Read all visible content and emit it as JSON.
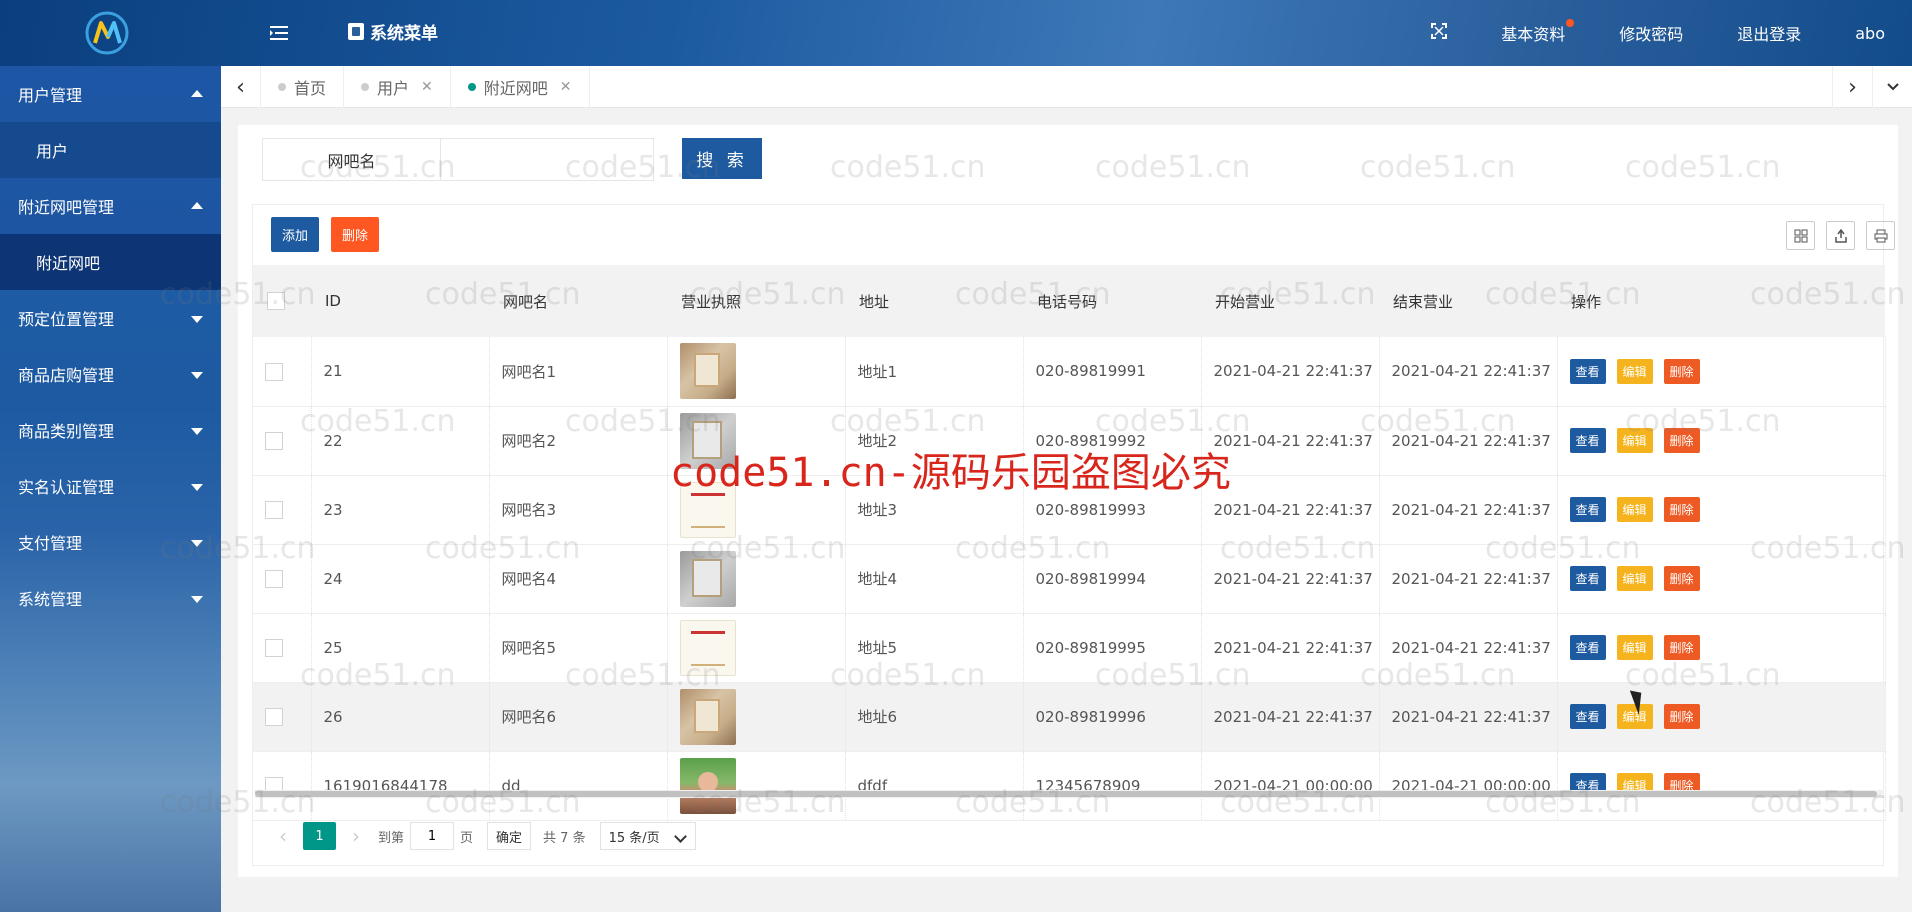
{
  "header": {
    "menu_title": "系统菜单",
    "right_links": [
      "基本资料",
      "修改密码",
      "退出登录"
    ],
    "username": "abo"
  },
  "sidebar": {
    "items": [
      {
        "label": "用户管理",
        "open": true,
        "children": [
          "用户"
        ]
      },
      {
        "label": "附近网吧管理",
        "open": true,
        "children": [
          "附近网吧"
        ]
      },
      {
        "label": "预定位置管理",
        "open": false
      },
      {
        "label": "商品店购管理",
        "open": false
      },
      {
        "label": "商品类别管理",
        "open": false
      },
      {
        "label": "实名认证管理",
        "open": false
      },
      {
        "label": "支付管理",
        "open": false
      },
      {
        "label": "系统管理",
        "open": false
      }
    ]
  },
  "tabs": [
    {
      "label": "首页",
      "closable": false
    },
    {
      "label": "用户",
      "closable": true
    },
    {
      "label": "附近网吧",
      "closable": true,
      "active": true
    }
  ],
  "search": {
    "label": "网吧名",
    "value": "",
    "button": "搜 索"
  },
  "toolbar": {
    "add_label": "添加",
    "delete_label": "删除"
  },
  "table": {
    "columns": [
      "ID",
      "网吧名",
      "营业执照",
      "地址",
      "电话号码",
      "开始营业",
      "结束营业",
      "操作"
    ],
    "rows": [
      {
        "id": "21",
        "name": "网吧名1",
        "license": "cert",
        "address": "地址1",
        "phone": "020-89819991",
        "start": "2021-04-21 22:41:37",
        "end": "2021-04-21 22:41:37"
      },
      {
        "id": "22",
        "name": "网吧名2",
        "license": "cert2",
        "address": "地址2",
        "phone": "020-89819992",
        "start": "2021-04-21 22:41:37",
        "end": "2021-04-21 22:41:37"
      },
      {
        "id": "23",
        "name": "网吧名3",
        "license": "cert3",
        "address": "地址3",
        "phone": "020-89819993",
        "start": "2021-04-21 22:41:37",
        "end": "2021-04-21 22:41:37"
      },
      {
        "id": "24",
        "name": "网吧名4",
        "license": "cert2",
        "address": "地址4",
        "phone": "020-89819994",
        "start": "2021-04-21 22:41:37",
        "end": "2021-04-21 22:41:37"
      },
      {
        "id": "25",
        "name": "网吧名5",
        "license": "cert3",
        "address": "地址5",
        "phone": "020-89819995",
        "start": "2021-04-21 22:41:37",
        "end": "2021-04-21 22:41:37"
      },
      {
        "id": "26",
        "name": "网吧名6",
        "license": "cert",
        "address": "地址6",
        "phone": "020-89819996",
        "start": "2021-04-21 22:41:37",
        "end": "2021-04-21 22:41:37",
        "highlighted": true
      },
      {
        "id": "1619016844178",
        "name": "dd",
        "license": "photo",
        "address": "dfdf",
        "phone": "12345678909",
        "start": "2021-04-21 00:00:00",
        "end": "2021-04-21 00:00:00"
      }
    ],
    "row_actions": [
      "查看",
      "编辑",
      "删除"
    ]
  },
  "pagination": {
    "current_page": "1",
    "goto_prefix": "到第",
    "goto_value": "1",
    "goto_suffix": "页",
    "confirm": "确定",
    "total": "共 7 条",
    "page_size": "15 条/页"
  },
  "watermark": {
    "repeat_text": "code51.cn",
    "main_text": "code51.cn-源码乐园盗图必究"
  },
  "colors": {
    "primary": "#1e5aa0",
    "danger": "#ff5722",
    "warning": "#f5b41e",
    "active_dot": "#009688",
    "new_dot": "#ff5722"
  }
}
